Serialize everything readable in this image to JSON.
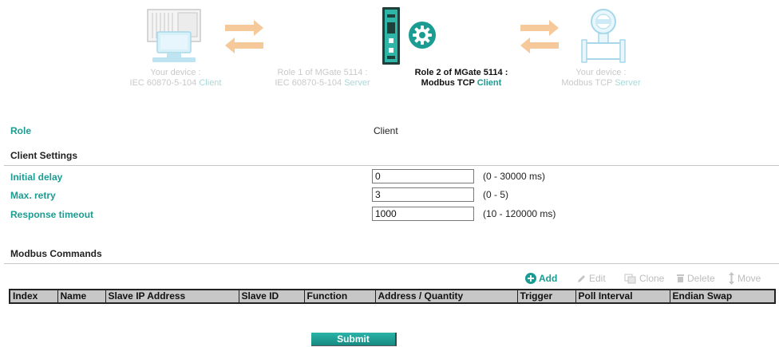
{
  "diagram": {
    "left_device": {
      "line1": "Your device :",
      "line2": "IEC 60870-5-104",
      "accent": "Client"
    },
    "role1": {
      "line1": "Role 1 of MGate 5114 :",
      "line2": "IEC 60870-5-104",
      "accent": "Server"
    },
    "role2": {
      "line1": "Role 2 of MGate 5114 :",
      "line2": "Modbus TCP",
      "accent": "Client"
    },
    "right_device": {
      "line1": "Your device :",
      "line2": "Modbus TCP",
      "accent": "Server"
    }
  },
  "role": {
    "label": "Role",
    "value": "Client"
  },
  "client_settings": {
    "title": "Client Settings",
    "fields": [
      {
        "label": "Initial delay",
        "value": "0",
        "hint": "(0 - 30000 ms)"
      },
      {
        "label": "Max. retry",
        "value": "3",
        "hint": "(0 - 5)"
      },
      {
        "label": "Response timeout",
        "value": "1000",
        "hint": "(10 - 120000 ms)"
      }
    ]
  },
  "modbus_commands": {
    "title": "Modbus Commands",
    "toolbar": {
      "add": "Add",
      "edit": "Edit",
      "clone": "Clone",
      "delete": "Delete",
      "move": "Move"
    },
    "columns": [
      "Index",
      "Name",
      "Slave IP Address",
      "Slave ID",
      "Function",
      "Address / Quantity",
      "Trigger",
      "Poll Interval",
      "Endian Swap"
    ]
  },
  "submit_label": "Submit",
  "colors": {
    "accent": "#1a9c92",
    "arrow": "#f6c99b",
    "header_bg": "#c7c7c7",
    "disabled": "#bdbdbd"
  }
}
